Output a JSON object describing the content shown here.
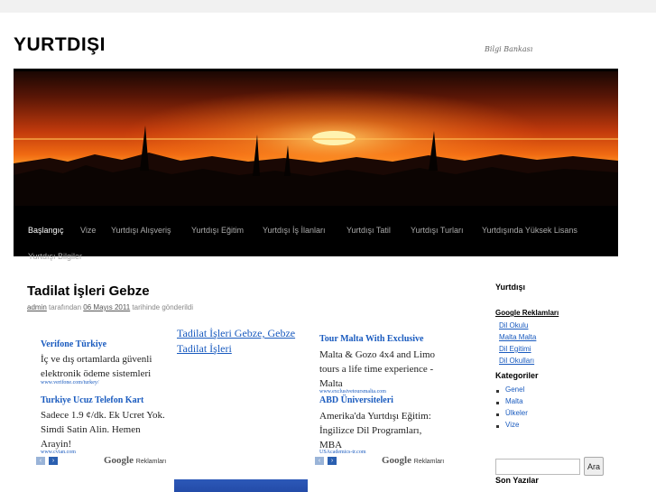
{
  "site": {
    "title": "YURTDIŞI",
    "description": "Bilgi Bankası"
  },
  "nav": {
    "items": [
      {
        "label": "Başlangıç"
      },
      {
        "label": "Vize"
      },
      {
        "label": "Yurtdışı Alışveriş"
      },
      {
        "label": "Yurtdışı Eğitim"
      },
      {
        "label": "Yurtdışı İş İlanları"
      },
      {
        "label": "Yurtdışı Tatil"
      },
      {
        "label": "Yurtdışı Turları"
      },
      {
        "label": "Yurtdışında Yüksek Lisans"
      },
      {
        "label": "Yurtdışı Bilgiler"
      }
    ]
  },
  "post": {
    "title": "Tadilat İşleri Gebze",
    "author": "admin",
    "by_text": "tarafından",
    "date": "06 Mayıs 2011",
    "date_suffix": "tarihinde gönderildi"
  },
  "ads_left": {
    "items": [
      {
        "title": "Verifone Türkiye",
        "body": "İç ve dış ortamlarda güvenli elektronik ödeme sistemleri",
        "url": "www.verifone.com/turkey/"
      },
      {
        "title": "Turkiye Ucuz Telefon Kart",
        "body": "Sadece 1.9 ¢/dk. Ek Ucret Yok. Simdi Satin Alin. Hemen Arayin!",
        "url": "www.cvian.com"
      }
    ],
    "prev": "‹",
    "next": "›",
    "google": "Google",
    "google_suffix": "Reklamları"
  },
  "link_unit": {
    "text": "Tadilat İşleri Gebze, Gebze Tadilat İşleri"
  },
  "ads_right": {
    "items": [
      {
        "title": "Tour Malta With Exclusive",
        "body": "Malta & Gozo 4x4 and Limo tours a life time experience - Malta",
        "url": "www.exclusivetoursmalta.com"
      },
      {
        "title": "ABD Üniversiteleri",
        "body": "Amerika'da Yurtdışı Eğitim: İngilizce Dil Programları, MBA",
        "url": "USAcademics-tr.com"
      }
    ],
    "prev": "‹",
    "next": "›",
    "google": "Google",
    "google_suffix": "Reklamları"
  },
  "sidebar": {
    "widget1_title": "Yurtdışı",
    "google_ads_label": "Google Reklamları",
    "ad_links": [
      "Dil Okulu",
      "Malta Malta",
      "Dil Egitimi",
      "Dil Okulları"
    ],
    "categories_title": "Kategoriler",
    "categories": [
      "Genel",
      "Malta",
      "Ülkeler",
      "Vize"
    ],
    "search_button": "Ara",
    "search_value": "",
    "recent_title": "Son Yazılar"
  }
}
